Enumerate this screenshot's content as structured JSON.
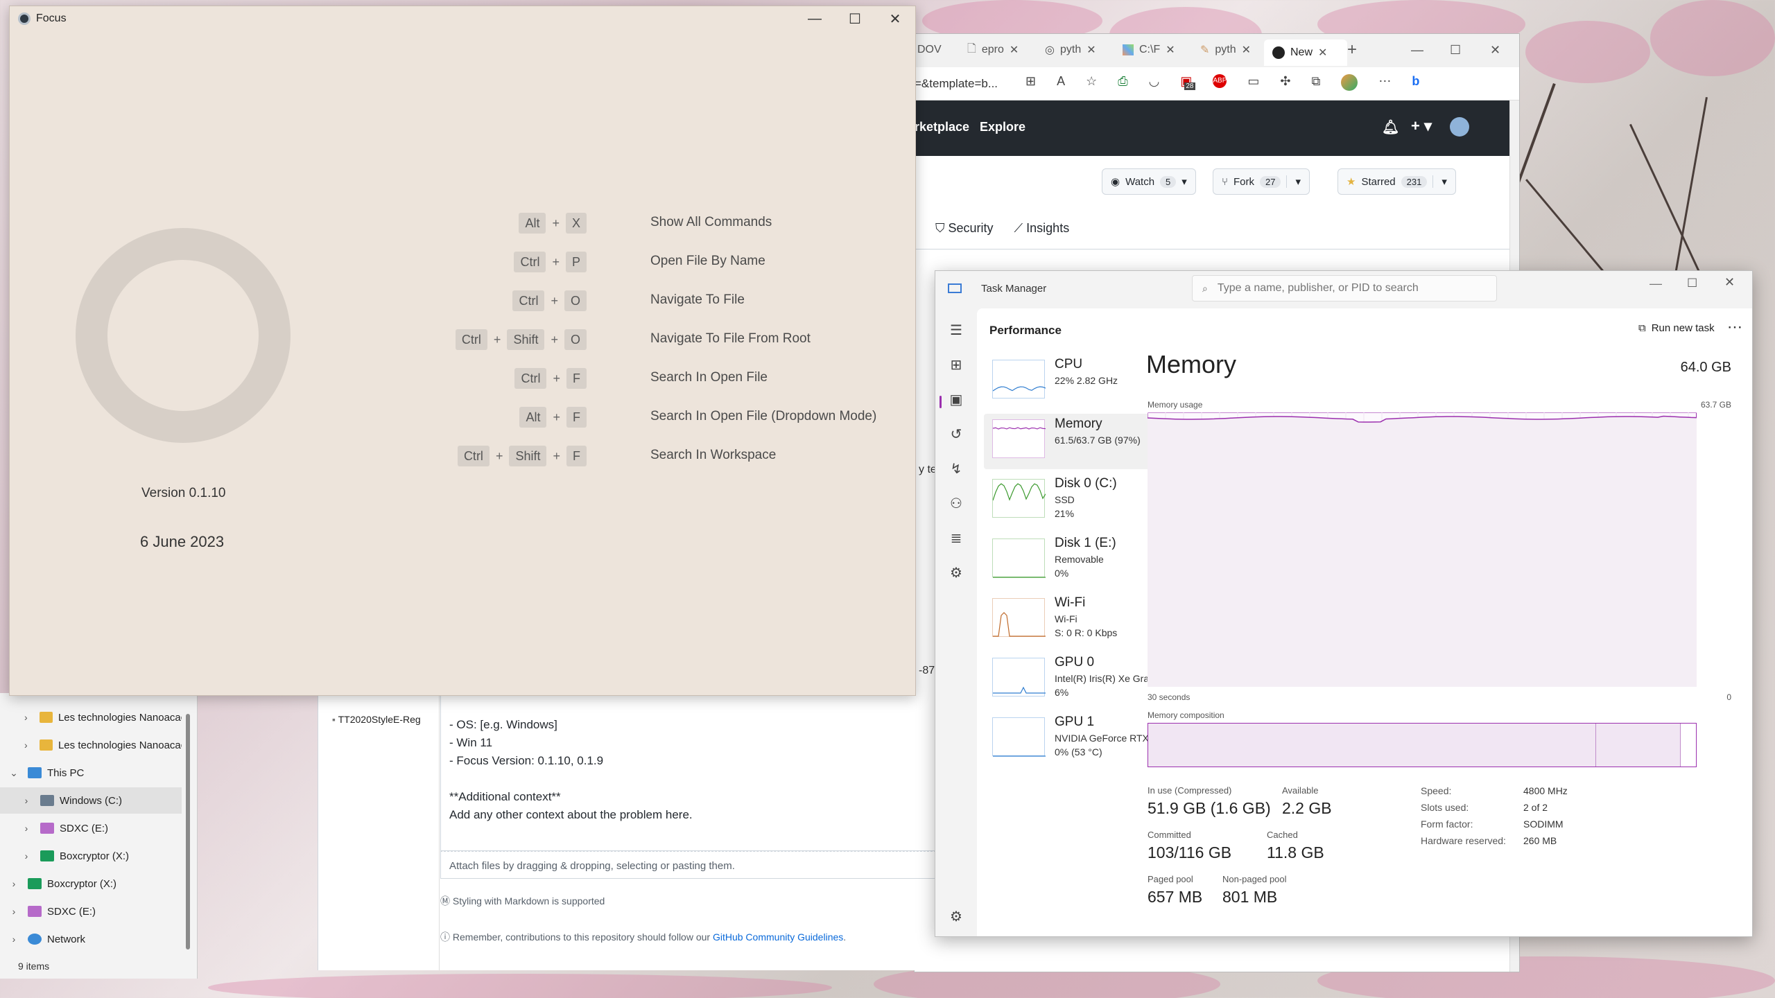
{
  "focus": {
    "title": "Focus",
    "version": "Version 0.1.10",
    "date": "6 June 2023",
    "shortcuts": [
      {
        "keys": [
          "Alt",
          "X"
        ],
        "command": "Show All Commands"
      },
      {
        "keys": [
          "Ctrl",
          "P"
        ],
        "command": "Open File By Name"
      },
      {
        "keys": [
          "Ctrl",
          "O"
        ],
        "command": "Navigate To File"
      },
      {
        "keys": [
          "Ctrl",
          "Shift",
          "O"
        ],
        "command": "Navigate To File From Root"
      },
      {
        "keys": [
          "Ctrl",
          "F"
        ],
        "command": "Search In Open File"
      },
      {
        "keys": [
          "Alt",
          "F"
        ],
        "command": "Search In Open File (Dropdown Mode)"
      },
      {
        "keys": [
          "Ctrl",
          "Shift",
          "F"
        ],
        "command": "Search In Workspace"
      }
    ]
  },
  "browser": {
    "tabs": [
      "DOV",
      "epro",
      "pyth",
      "C:\\F",
      "pyth",
      "New"
    ],
    "url": "=&template=b...",
    "ext_badge": "28",
    "nav": [
      "rketplace",
      "Explore"
    ],
    "watch": {
      "label": "Watch",
      "count": "5"
    },
    "fork": {
      "label": "Fork",
      "count": "27"
    },
    "star": {
      "label": "Starred",
      "count": "231"
    },
    "subnav": [
      "Security",
      "Insights"
    ]
  },
  "issue": {
    "lines": [
      "- OS: [e.g. Windows]",
      "- Win 11",
      "- Focus Version: 0.1.10, 0.1.9",
      "",
      "**Additional context**",
      "Add any other context about the problem here."
    ],
    "attach": "Attach files by dragging & dropping, selecting or pasting them.",
    "markdown": "Styling with Markdown is supported",
    "remember": "Remember, contributions to this repository should follow our ",
    "guidelines": "GitHub Community Guidelines",
    "side_text": "y te",
    "side_text2": "-87"
  },
  "explorer": {
    "items": [
      {
        "label": "Les technologies Nanoacac",
        "type": "folder",
        "indent": 1
      },
      {
        "label": "Les technologies Nanoacac",
        "type": "folder",
        "indent": 1
      },
      {
        "label": "This PC",
        "type": "pc",
        "indent": 0
      },
      {
        "label": "Windows (C:)",
        "type": "drive",
        "indent": 1
      },
      {
        "label": "SDXC (E:)",
        "type": "sd",
        "indent": 1
      },
      {
        "label": "Boxcryptor (X:)",
        "type": "box",
        "indent": 1
      },
      {
        "label": "Boxcryptor (X:)",
        "type": "box",
        "indent": 0
      },
      {
        "label": "SDXC (E:)",
        "type": "sd",
        "indent": 0
      },
      {
        "label": "Network",
        "type": "net",
        "indent": 0
      }
    ],
    "file": "TT2020StyleE-Reg",
    "status": "9 items"
  },
  "taskmanager": {
    "title": "Task Manager",
    "search_placeholder": "Type a name, publisher, or PID to search",
    "section": "Performance",
    "run_new_task": "Run new task",
    "items": [
      {
        "name": "CPU",
        "l2": "22%  2.82 GHz",
        "l3": ""
      },
      {
        "name": "Memory",
        "l2": "61.5/63.7 GB (97%)",
        "l3": ""
      },
      {
        "name": "Disk 0 (C:)",
        "l2": "SSD",
        "l3": "21%"
      },
      {
        "name": "Disk 1 (E:)",
        "l2": "Removable",
        "l3": "0%"
      },
      {
        "name": "Wi-Fi",
        "l2": "Wi-Fi",
        "l3": "S: 0  R: 0 Kbps"
      },
      {
        "name": "GPU 0",
        "l2": "Intel(R) Iris(R) Xe Gra...",
        "l3": "6%"
      },
      {
        "name": "GPU 1",
        "l2": "NVIDIA GeForce RTX...",
        "l3": "0% (53 °C)"
      }
    ],
    "memory": {
      "title": "Memory",
      "total": "64.0 GB",
      "usage_label": "Memory usage",
      "usage_max": "63.7 GB",
      "time_left": "30 seconds",
      "time_right": "0",
      "composition_label": "Memory composition",
      "stats": {
        "in_use_label": "In use (Compressed)",
        "in_use": "51.9 GB (1.6 GB)",
        "available_label": "Available",
        "available": "2.2 GB",
        "committed_label": "Committed",
        "committed": "103/116 GB",
        "cached_label": "Cached",
        "cached": "11.8 GB",
        "paged_label": "Paged pool",
        "paged": "657 MB",
        "nonpaged_label": "Non-paged pool",
        "nonpaged": "801 MB"
      },
      "specs": [
        {
          "k": "Speed:",
          "v": "4800 MHz"
        },
        {
          "k": "Slots used:",
          "v": "2 of 2"
        },
        {
          "k": "Form factor:",
          "v": "SODIMM"
        },
        {
          "k": "Hardware reserved:",
          "v": "260 MB"
        }
      ]
    }
  },
  "colors": {
    "memory_accent": "#9b2fae",
    "memory_fill": "#f4eef5",
    "focus_bg": "#ede4db"
  }
}
